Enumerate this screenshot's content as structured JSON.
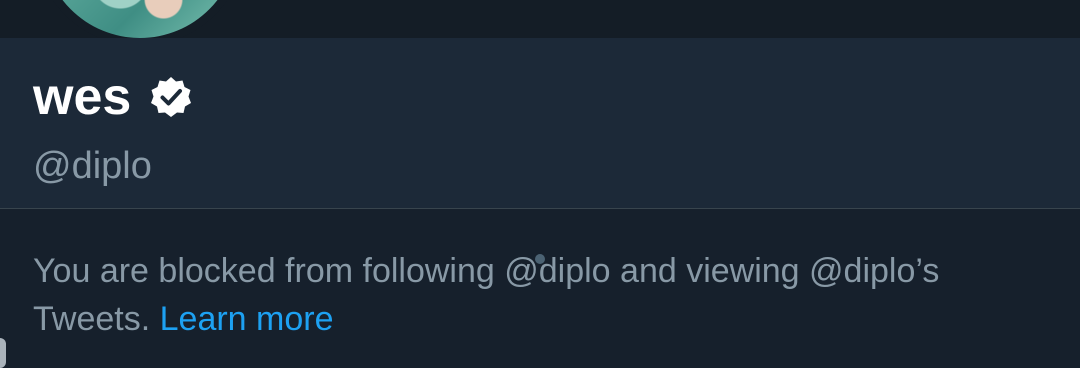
{
  "profile": {
    "display_name": "wes",
    "verified": true,
    "handle": "@diplo"
  },
  "blocked_notice": {
    "text": "You are blocked from following @diplo and viewing @diplo’s Tweets.",
    "link_label": "Learn more"
  },
  "icons": {
    "verified": "verified-badge-icon"
  },
  "colors": {
    "background": "#16202c",
    "profile_background": "#1c2938",
    "primary_text": "#ffffff",
    "secondary_text": "#8899a6",
    "link": "#1da1f2"
  }
}
